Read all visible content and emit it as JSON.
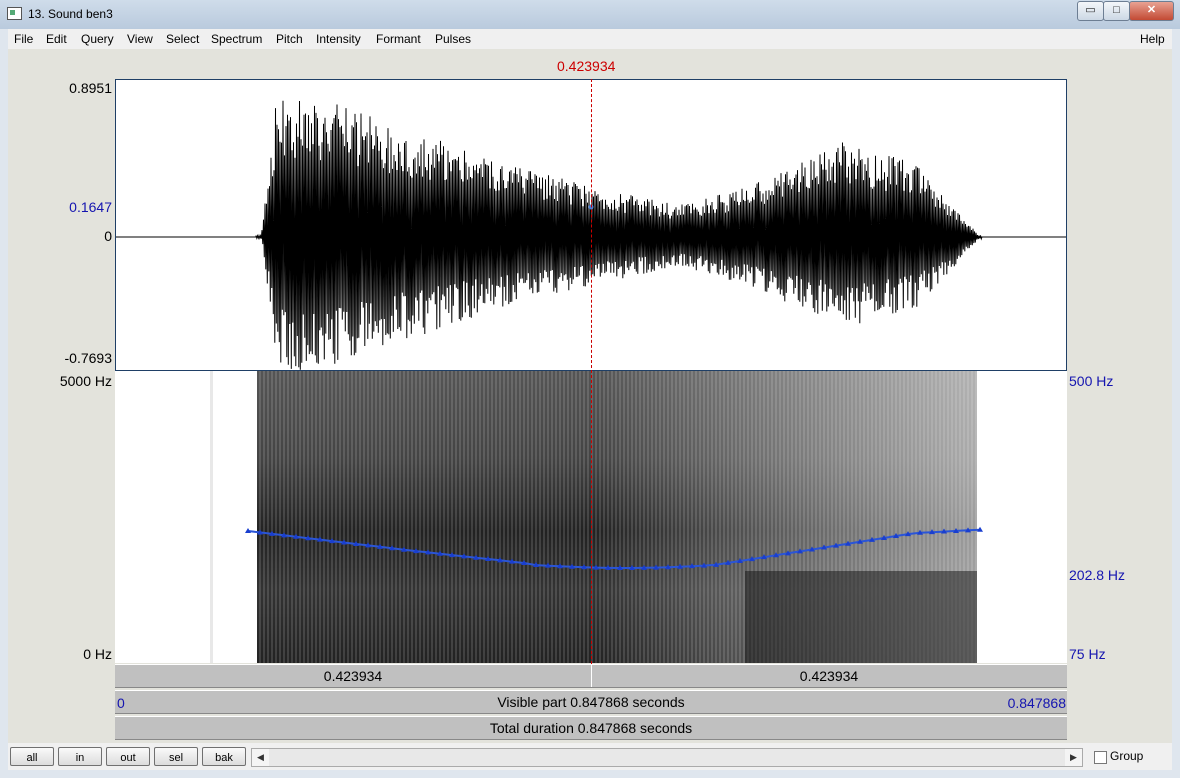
{
  "window": {
    "title": "13. Sound ben3",
    "controls": {
      "minimize": "▭",
      "maximize": "□",
      "close": "✕"
    }
  },
  "menu": [
    "File",
    "Edit",
    "Query",
    "View",
    "Select",
    "Spectrum",
    "Pitch",
    "Intensity",
    "Formant",
    "Pulses"
  ],
  "help": "Help",
  "cursor": {
    "time_label": "0.423934",
    "time": 0.423934,
    "value_label": "0.1647"
  },
  "waveform": {
    "y_max": "0.8951",
    "y_min": "-0.7693",
    "zero": "0"
  },
  "spectrogram": {
    "freq_top": "5000 Hz",
    "freq_bottom": "0 Hz"
  },
  "pitch": {
    "top": "500 Hz",
    "value": "202.8 Hz",
    "bottom": "75 Hz"
  },
  "timebars": {
    "left_part": "0.423934",
    "right_part": "0.423934",
    "visible_start": "0",
    "visible_end": "0.847868",
    "visible_text": "Visible part 0.847868 seconds",
    "total_text": "Total duration 0.847868 seconds"
  },
  "toolbar": {
    "all": "all",
    "in": "in",
    "out": "out",
    "sel": "sel",
    "bak": "bak",
    "group": "Group"
  },
  "colors": {
    "cursor": "#cc0000",
    "pitch": "#1a3fcf",
    "frame": "#1f3f66"
  }
}
